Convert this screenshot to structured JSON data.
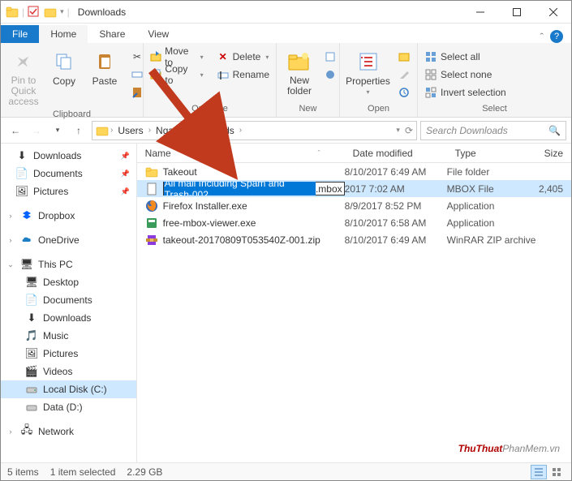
{
  "window": {
    "title": "Downloads"
  },
  "tabs": {
    "file": "File",
    "home": "Home",
    "share": "Share",
    "view": "View"
  },
  "ribbon": {
    "clipboard": {
      "pin": "Pin to Quick\naccess",
      "copy": "Copy",
      "paste": "Paste",
      "label": "Clipboard"
    },
    "organize": {
      "moveto": "Move to",
      "copyto": "Copy to",
      "delete": "Delete",
      "rename": "Rename",
      "label": "Organize"
    },
    "new": {
      "newfolder": "New\nfolder",
      "label": "New"
    },
    "open": {
      "properties": "Properties",
      "label": "Open"
    },
    "select": {
      "all": "Select all",
      "none": "Select none",
      "invert": "Invert selection",
      "label": "Select"
    }
  },
  "breadcrumb": {
    "p1": "Users",
    "p2": "Nga",
    "p3": "Downloads"
  },
  "search": {
    "placeholder": "Search Downloads"
  },
  "columns": {
    "name": "Name",
    "date": "Date modified",
    "type": "Type",
    "size": "Size"
  },
  "nav": {
    "downloads": "Downloads",
    "documents": "Documents",
    "pictures": "Pictures",
    "dropbox": "Dropbox",
    "onedrive": "OneDrive",
    "thispc": "This PC",
    "desktop": "Desktop",
    "music": "Music",
    "videos": "Videos",
    "localdisk": "Local Disk (C:)",
    "datad": "Data (D:)",
    "network": "Network"
  },
  "files": [
    {
      "name": "Takeout",
      "date": "8/10/2017 6:49 AM",
      "type": "File folder",
      "size": ""
    },
    {
      "name_sel": "All mail Including Spam and Trash-002",
      "name_rest": ".mbox",
      "date": "2017 7:02 AM",
      "type": "MBOX File",
      "size": "2,405"
    },
    {
      "name": "Firefox Installer.exe",
      "date": "8/9/2017 8:52 PM",
      "type": "Application",
      "size": ""
    },
    {
      "name": "free-mbox-viewer.exe",
      "date": "8/10/2017 6:58 AM",
      "type": "Application",
      "size": ""
    },
    {
      "name": "takeout-20170809T053540Z-001.zip",
      "date": "8/10/2017 6:49 AM",
      "type": "WinRAR ZIP archive",
      "size": ""
    }
  ],
  "status": {
    "count": "5 items",
    "selected": "1 item selected",
    "size": "2.29 GB"
  },
  "watermark": {
    "a": "ThuThuat",
    "b": "PhanMem",
    "c": ".vn"
  }
}
